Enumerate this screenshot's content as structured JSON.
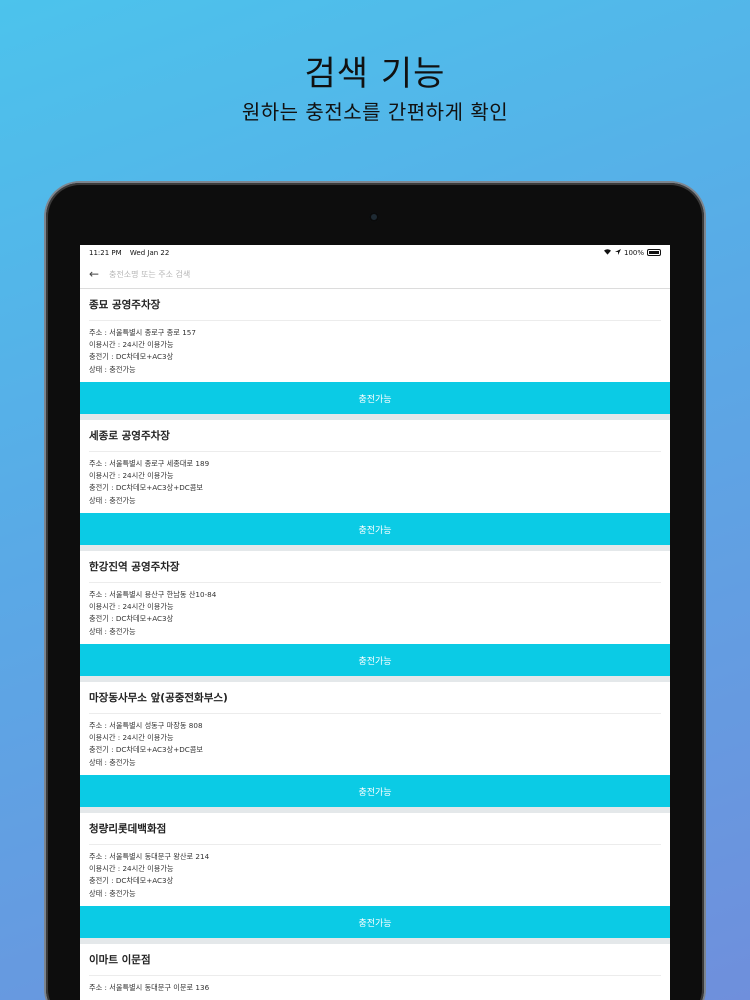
{
  "hero": {
    "title": "검색 기능",
    "subtitle": "원하는 충전소를 간편하게 확인"
  },
  "status_bar": {
    "time": "11:21 PM",
    "date": "Wed Jan 22",
    "battery": "100%"
  },
  "search": {
    "placeholder": "충전소명 또는 주소 검색"
  },
  "stations": [
    {
      "name": "종묘 공영주차장",
      "address": "주소 : 서울특별시 종로구 종로 157",
      "hours": "이용시간 : 24시간 이용가능",
      "charger": "충전기 : DC차데모+AC3상",
      "state": "상태 : 충전가능",
      "button": "충전가능"
    },
    {
      "name": "세종로 공영주차장",
      "address": "주소 : 서울특별시 종로구 세종대로 189",
      "hours": "이용시간 : 24시간 이용가능",
      "charger": "충전기 : DC차데모+AC3상+DC콤보",
      "state": "상태 : 충전가능",
      "button": "충전가능"
    },
    {
      "name": "한강진역 공영주차장",
      "address": "주소 : 서울특별시 용산구 한남동 산10-84",
      "hours": "이용시간 : 24시간 이용가능",
      "charger": "충전기 : DC차데모+AC3상",
      "state": "상태 : 충전가능",
      "button": "충전가능"
    },
    {
      "name": "마장동사무소 앞(공중전화부스)",
      "address": "주소 : 서울특별시 성동구 마장동 808",
      "hours": "이용시간 : 24시간 이용가능",
      "charger": "충전기 : DC차데모+AC3상+DC콤보",
      "state": "상태 : 충전가능",
      "button": "충전가능"
    },
    {
      "name": "청량리롯데백화점",
      "address": "주소 : 서울특별시 동대문구 왕산로 214",
      "hours": "이용시간 : 24시간 이용가능",
      "charger": "충전기 : DC차데모+AC3상",
      "state": "상태 : 충전가능",
      "button": "충전가능"
    },
    {
      "name": "이마트 이문점",
      "address": "주소 : 서울특별시 동대문구 이문로 136",
      "hours": "",
      "charger": "",
      "state": "",
      "button": ""
    }
  ]
}
